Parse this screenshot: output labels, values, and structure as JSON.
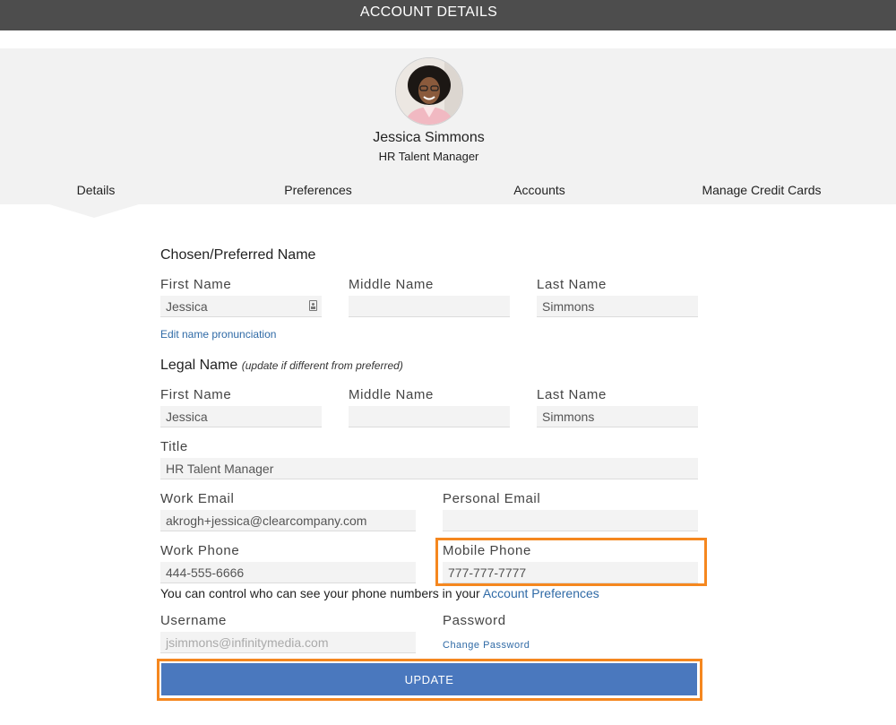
{
  "header": {
    "title": "ACCOUNT DETAILS"
  },
  "profile": {
    "name": "Jessica Simmons",
    "job_title": "HR Talent Manager"
  },
  "tabs": [
    {
      "label": "Details",
      "active": true
    },
    {
      "label": "Preferences"
    },
    {
      "label": "Accounts"
    },
    {
      "label": "Manage Credit Cards"
    }
  ],
  "preferred": {
    "heading": "Chosen/Preferred Name",
    "first_label": "First Name",
    "first_value": "Jessica",
    "middle_label": "Middle Name",
    "middle_value": "",
    "last_label": "Last Name",
    "last_value": "Simmons",
    "pronunciation_link": "Edit name pronunciation"
  },
  "legal": {
    "heading": "Legal Name",
    "note": "(update if different from preferred)",
    "first_label": "First Name",
    "first_value": "Jessica",
    "middle_label": "Middle Name",
    "middle_value": "",
    "last_label": "Last Name",
    "last_value": "Simmons"
  },
  "title_field": {
    "label": "Title",
    "value": "HR Talent Manager"
  },
  "work_email": {
    "label": "Work Email",
    "value": "akrogh+jessica@clearcompany.com"
  },
  "personal_email": {
    "label": "Personal Email",
    "value": ""
  },
  "work_phone": {
    "label": "Work Phone",
    "value": "444-555-6666"
  },
  "mobile_phone": {
    "label": "Mobile Phone",
    "value": "777-777-7777"
  },
  "phone_note": {
    "text": "You can control who can see your phone numbers in your ",
    "link": "Account Preferences"
  },
  "username": {
    "label": "Username",
    "value": "jsimmons@infinitymedia.com"
  },
  "password": {
    "label": "Password",
    "link": "Change Password"
  },
  "update_button": "UPDATE",
  "colors": {
    "header_bg": "#4d4d4d",
    "panel_bg": "#f2f2f2",
    "accent_button": "#4a78be",
    "link": "#2f6aa6",
    "highlight": "#f5871f"
  }
}
